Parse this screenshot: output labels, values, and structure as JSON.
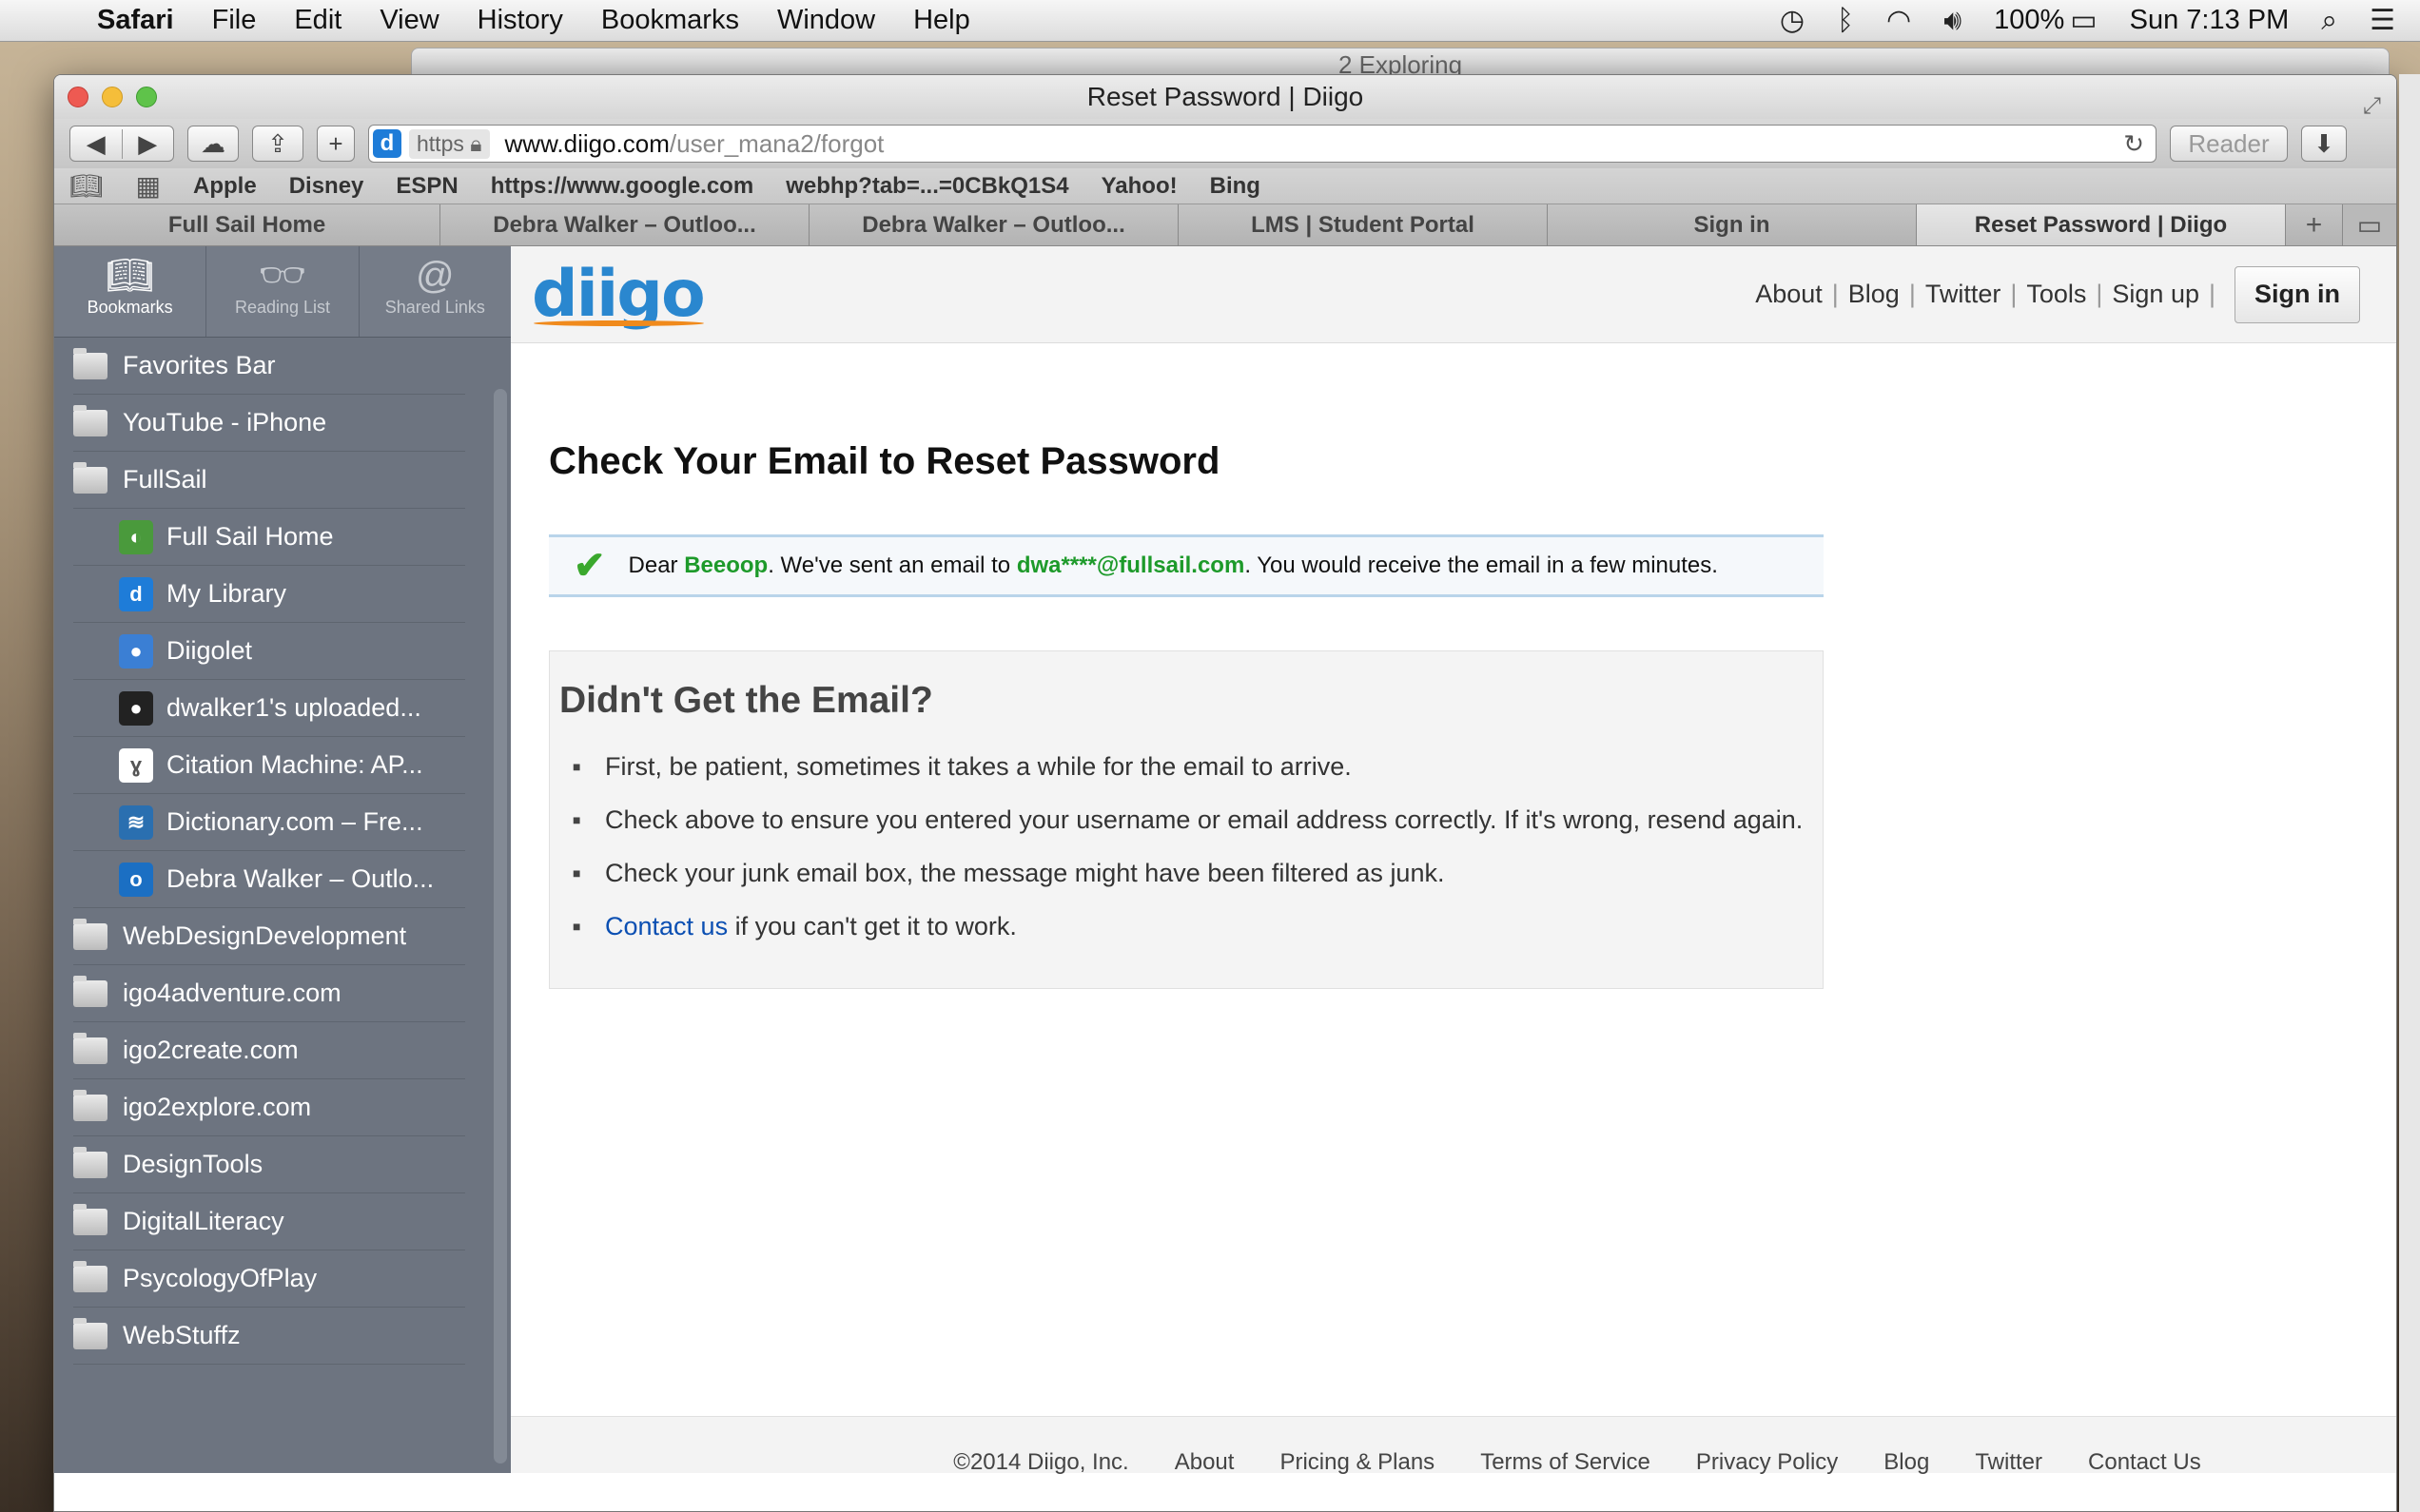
{
  "menubar": {
    "app": "Safari",
    "items": [
      "File",
      "Edit",
      "View",
      "History",
      "Bookmarks",
      "Window",
      "Help"
    ],
    "battery": "100%",
    "clock": "Sun 7:13 PM"
  },
  "background_window": {
    "title": "2 Exploring"
  },
  "window": {
    "title": "Reset Password | Diigo",
    "url": {
      "scheme": "https",
      "domain": "www.diigo.com",
      "path": "/user_mana2/forgot"
    },
    "reader_label": "Reader"
  },
  "favorites": [
    "Apple",
    "Disney",
    "ESPN",
    "https://www.google.com",
    "webhp?tab=...=0CBkQ1S4",
    "Yahoo!",
    "Bing"
  ],
  "tabs": [
    {
      "label": "Full Sail Home"
    },
    {
      "label": "Debra Walker – Outloo..."
    },
    {
      "label": "Debra Walker – Outloo..."
    },
    {
      "label": "LMS | Student Portal"
    },
    {
      "label": "Sign in"
    },
    {
      "label": "Reset Password | Diigo"
    }
  ],
  "sidebar": {
    "tabs": [
      {
        "label": "Bookmarks",
        "icon": "book-icon"
      },
      {
        "label": "Reading List",
        "icon": "glasses-icon"
      },
      {
        "label": "Shared Links",
        "icon": "at-icon"
      }
    ],
    "items": [
      {
        "label": "Favorites Bar",
        "type": "folder"
      },
      {
        "label": "YouTube - iPhone",
        "type": "folder"
      },
      {
        "label": "FullSail",
        "type": "folder"
      },
      {
        "label": "Full Sail Home",
        "type": "bookmark",
        "icon": "fullsail-icon",
        "color": "#4a9a3c"
      },
      {
        "label": "My Library",
        "type": "bookmark",
        "icon": "diigo-icon",
        "color": "#1e7cd8"
      },
      {
        "label": "Diigolet",
        "type": "bookmark",
        "icon": "globe-icon",
        "color": "#3b7fd4"
      },
      {
        "label": "dwalker1's uploaded...",
        "type": "bookmark",
        "icon": "dot-icon",
        "color": "#222222"
      },
      {
        "label": "Citation Machine: AP...",
        "type": "bookmark",
        "icon": "squirrel-icon",
        "color": "#ffffff"
      },
      {
        "label": "Dictionary.com – Fre...",
        "type": "bookmark",
        "icon": "dictionary-icon",
        "color": "#2a6fb0"
      },
      {
        "label": "Debra Walker – Outlo...",
        "type": "bookmark",
        "icon": "outlook-icon",
        "color": "#1b6fc3"
      },
      {
        "label": "WebDesignDevelopment",
        "type": "folder"
      },
      {
        "label": "igo4adventure.com",
        "type": "folder"
      },
      {
        "label": "igo2create.com",
        "type": "folder"
      },
      {
        "label": "igo2explore.com",
        "type": "folder"
      },
      {
        "label": "DesignTools",
        "type": "folder"
      },
      {
        "label": "DigitalLiteracy",
        "type": "folder"
      },
      {
        "label": "PsycologyOfPlay",
        "type": "folder"
      },
      {
        "label": "WebStuffz",
        "type": "folder"
      }
    ]
  },
  "page": {
    "logo": "diigo",
    "nav": [
      "About",
      "Blog",
      "Twitter",
      "Tools",
      "Sign up"
    ],
    "signin": "Sign in",
    "title": "Check Your Email to Reset Password",
    "notice": {
      "prefix": "Dear ",
      "username": "Beeoop",
      "middle": ". We've sent an email to ",
      "email": "dwa****@fullsail.com",
      "suffix": ". You would receive the email in a few minutes."
    },
    "help": {
      "heading": "Didn't Get the Email?",
      "items": [
        "First, be patient, sometimes it takes a while for the email to arrive.",
        "Check above to ensure you entered your username or email address correctly. If it's wrong, resend again.",
        "Check your junk email box, the message might have been filtered as junk."
      ],
      "contact_link": "Contact us",
      "contact_suffix": " if you can't get it to work."
    },
    "footer": [
      "©2014 Diigo, Inc.",
      "About",
      "Pricing & Plans",
      "Terms of Service",
      "Privacy Policy",
      "Blog",
      "Twitter",
      "Contact Us"
    ]
  },
  "colors": {
    "accent_green": "#1d9a2a",
    "link_blue": "#0b4fb2",
    "logo_blue": "#2a87cf",
    "logo_orange": "#f08a1c"
  }
}
